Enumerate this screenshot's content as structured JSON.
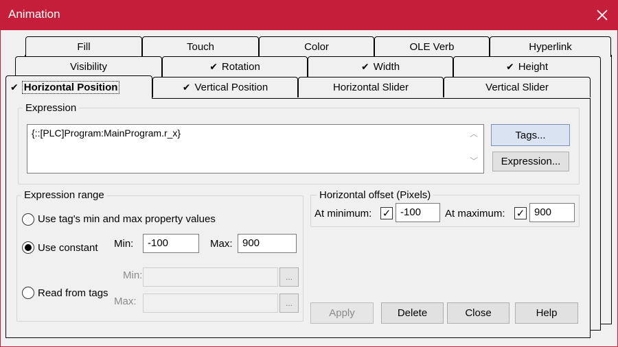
{
  "window": {
    "title": "Animation",
    "close_glyph": "✕"
  },
  "tabs": {
    "row1": [
      {
        "label": "Fill",
        "checked": false
      },
      {
        "label": "Touch",
        "checked": false
      },
      {
        "label": "Color",
        "checked": false
      },
      {
        "label": "OLE Verb",
        "checked": false
      },
      {
        "label": "Hyperlink",
        "checked": false
      }
    ],
    "row2": [
      {
        "label": "Visibility",
        "checked": false
      },
      {
        "label": "Rotation",
        "checked": true
      },
      {
        "label": "Width",
        "checked": true
      },
      {
        "label": "Height",
        "checked": true
      }
    ],
    "row3": [
      {
        "label": "Horizontal Position",
        "checked": true,
        "active": true
      },
      {
        "label": "Vertical Position",
        "checked": true
      },
      {
        "label": "Horizontal Slider",
        "checked": false
      },
      {
        "label": "Vertical Slider",
        "checked": false
      }
    ],
    "check_glyph": "✔"
  },
  "expression": {
    "group_label": "Expression",
    "value": "{::[PLC]Program:MainProgram.r_x}",
    "tags_button": "Tags...",
    "expression_button": "Expression..."
  },
  "range": {
    "group_label": "Expression range",
    "option_tag_minmax": "Use tag's min and max property values",
    "option_constant": "Use constant",
    "option_read_tags": "Read from tags",
    "selected": "Use constant",
    "min_label": "Min:",
    "max_label": "Max:",
    "min_value": "-100",
    "max_value": "900",
    "tags_min_label": "Min:",
    "tags_max_label": "Max:",
    "browse_glyph": "..."
  },
  "offset": {
    "group_label": "Horizontal offset (Pixels)",
    "at_min_label": "At minimum:",
    "at_min_checked": true,
    "at_min_value": "-100",
    "at_max_label": "At maximum:",
    "at_max_checked": true,
    "at_max_value": "900",
    "check_glyph": "✓"
  },
  "buttons": {
    "apply": "Apply",
    "delete": "Delete",
    "close": "Close",
    "help": "Help"
  },
  "scroll": {
    "up_glyph": "︿",
    "down_glyph": "﹀"
  }
}
